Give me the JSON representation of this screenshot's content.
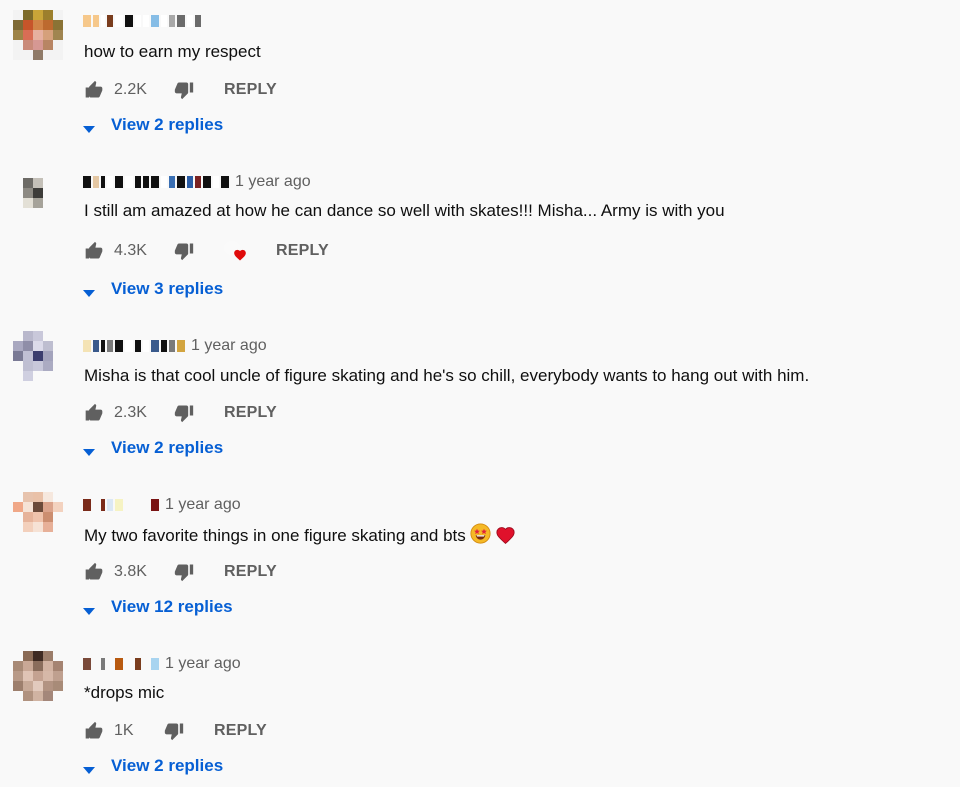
{
  "colors": {
    "link": "#065fd4",
    "meta": "#606060",
    "text": "#0f0f0f",
    "bg": "#f9f9f9",
    "heart": "#e00b0b"
  },
  "icons": {
    "like": "thumbs-up-icon",
    "dislike": "thumbs-down-icon",
    "expand": "caret-down-icon",
    "hearted": "creator-heart-icon"
  },
  "comments": [
    {
      "time": "",
      "text": "how to earn my respect",
      "likes": "2.2K",
      "reply_label": "REPLY",
      "replies_label": "View 2 replies",
      "hearted": false,
      "avatar": [
        "#f3f3f3",
        "#7d6b2a",
        "#c9a538",
        "#9c7f2c",
        "#f3f3f3",
        "#7e6a36",
        "#c7552a",
        "#d18447",
        "#bd6a2f",
        "#8a7335",
        "#9e8447",
        "#d96d55",
        "#e6b0a0",
        "#d5a07b",
        "#a08550",
        "#f3f3f3",
        "#c98a79",
        "#d69893",
        "#b88564",
        "#f3f3f3",
        "#f3f3f3",
        "#f3f3f3",
        "#8f7a68",
        "#f3f3f3",
        "#f3f3f3"
      ],
      "author_blocks": [
        "#f6c88b",
        "#f6c88b",
        "#ffffff",
        "#7a3d1e",
        "#ffffff",
        "#111111",
        "#ffffff",
        "#ffffff",
        "#86bde6",
        "#ffffff",
        "#a8a8a8",
        "#6b6b6b",
        "#ffffff",
        "#6b6b6b"
      ]
    },
    {
      "time": "1 year ago",
      "text": "I still am amazed at how he can dance so well with skates!!! Misha... Army is with you",
      "likes": "4.3K",
      "reply_label": "REPLY",
      "replies_label": "View 3 replies",
      "hearted": true,
      "avatar": [
        "#f9f9f9",
        "#f9f9f9",
        "#f9f9f9",
        "#f9f9f9",
        "#f9f9f9",
        "#f9f9f9",
        "#6d6b66",
        "#c4c0b8",
        "#f9f9f9",
        "#f9f9f9",
        "#f9f9f9",
        "#8d8a83",
        "#3d3c39",
        "#f9f9f9",
        "#f9f9f9",
        "#f9f9f9",
        "#e3e0d6",
        "#a6a39a",
        "#f9f9f9",
        "#f9f9f9",
        "#f9f9f9",
        "#f9f9f9",
        "#f9f9f9",
        "#f9f9f9",
        "#f9f9f9"
      ],
      "author_blocks": [
        "#111111",
        "#e4c7a3",
        "#111111",
        "#ffffff",
        "#111111",
        "#ffffff",
        "#111111",
        "#111111",
        "#111111",
        "#ffffff",
        "#3a6fb3",
        "#111111",
        "#2b5da6",
        "#7a2222",
        "#111111",
        "#ffffff",
        "#111111"
      ]
    },
    {
      "time": "1 year ago",
      "text": "Misha is that cool uncle of figure skating and he's so chill, everybody wants to hang out with him.",
      "likes": "2.3K",
      "reply_label": "REPLY",
      "replies_label": "View 2 replies",
      "hearted": false,
      "avatar": [
        "#f9f9f9",
        "#b9b8cc",
        "#c9c8da",
        "#f9f9f9",
        "#f9f9f9",
        "#a9a8c0",
        "#8f8ea8",
        "#dcdbea",
        "#bebed0",
        "#f9f9f9",
        "#7a7a95",
        "#c0c0d4",
        "#3b3d6e",
        "#a3a3bc",
        "#f9f9f9",
        "#f9f9f9",
        "#bfbfd2",
        "#c8c8da",
        "#ababc2",
        "#f9f9f9",
        "#f9f9f9",
        "#cfcfe0",
        "#f9f9f9",
        "#f9f9f9",
        "#f9f9f9"
      ],
      "author_blocks": [
        "#f4e3b5",
        "#3a5a8c",
        "#111111",
        "#7a7a7a",
        "#111111",
        "#ffffff",
        "#111111",
        "#ffffff",
        "#3a5a8c",
        "#111111",
        "#7a7a7a",
        "#d3a540"
      ]
    },
    {
      "time": "1 year ago",
      "text": "My two favorite things in one figure skating and bts",
      "likes": "3.8K",
      "reply_label": "REPLY",
      "replies_label": "View 12 replies",
      "hearted": false,
      "avatar": [
        "#f9f9f9",
        "#e7c3ad",
        "#e9c1a8",
        "#f6e8de",
        "#f9f9f9",
        "#f0a888",
        "#f6e3d6",
        "#6b4a3a",
        "#dba38b",
        "#f3d2bf",
        "#f9f9f9",
        "#e6b39a",
        "#efc3ac",
        "#cc8e70",
        "#f9f9f9",
        "#f9f9f9",
        "#f3d0bc",
        "#f6e2d5",
        "#e7b098",
        "#f9f9f9",
        "#f9f9f9",
        "#f9f9f9",
        "#f9f9f9",
        "#f9f9f9",
        "#f9f9f9"
      ],
      "author_blocks": [
        "#7a2b1a",
        "#f9f9f9",
        "#7a2b1a",
        "#dbe8f5",
        "#f6f3c3",
        "#f9f9f9",
        "#f9f9f9",
        "#f9f9f9",
        "#7a1414"
      ]
    },
    {
      "time": "1 year ago",
      "text": "*drops mic",
      "likes": "1K",
      "reply_label": "REPLY",
      "replies_label": "View 2 replies",
      "hearted": false,
      "avatar": [
        "#f9f9f9",
        "#8a6a55",
        "#3e2a22",
        "#9b7d6a",
        "#f9f9f9",
        "#a88a76",
        "#c9a896",
        "#8a6d5c",
        "#d2b3a2",
        "#a58472",
        "#b89a88",
        "#e0c4b5",
        "#c4a291",
        "#d6b8a8",
        "#bfa08f",
        "#9d7f6d",
        "#c8aa98",
        "#e2cabd",
        "#b29382",
        "#a88b78",
        "#f9f9f9",
        "#b0927f",
        "#d0b3a2",
        "#a4877a",
        "#f9f9f9"
      ],
      "author_blocks": [
        "#7a4a3a",
        "#f9f9f9",
        "#7a7a7a",
        "#f9f9f9",
        "#b85a10",
        "#f9f9f9",
        "#7a3d1e",
        "#f9f9f9",
        "#a8d4f0"
      ]
    }
  ]
}
